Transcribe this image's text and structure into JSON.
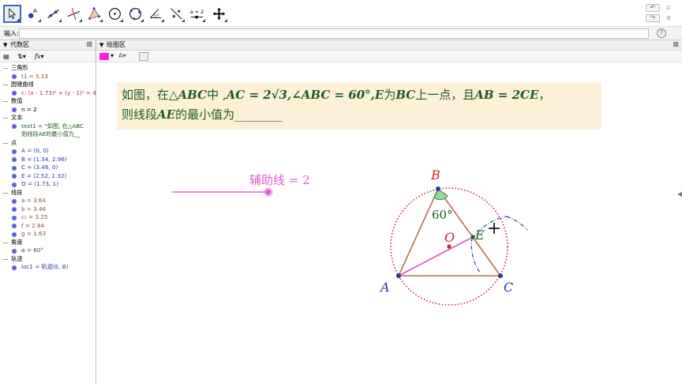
{
  "toolbar": {
    "tools": [
      "move-tool",
      "point-tool",
      "line-tool",
      "perpendicular-tool",
      "polygon-tool",
      "circle-tool",
      "circle-3points-tool",
      "angle-tool",
      "reflect-tool",
      "slider-tool",
      "move-view-tool"
    ],
    "slider_tool_label": "a = 2",
    "point_tool_label": "A"
  },
  "input_bar": {
    "label": "输入:",
    "value": ""
  },
  "algebra": {
    "title": "代数区",
    "categories": [
      {
        "name": "三角形",
        "items": [
          "t1 = 5.13"
        ]
      },
      {
        "name": "圆锥曲线",
        "items": [
          "c: (x - 1.73)² + (y - 1)² = 4"
        ]
      },
      {
        "name": "数值",
        "items": [
          "n = 2"
        ]
      },
      {
        "name": "文本",
        "items": [
          "text1 = \"如图, 在△ABC",
          "则线段AE的最小值为__"
        ]
      },
      {
        "name": "点",
        "items": [
          "A = (0, 0)",
          "B = (1.34, 2.96)",
          "C = (3.46, 0)",
          "E = (2.52, 1.32)",
          "O = (1.73, 1)"
        ]
      },
      {
        "name": "线段",
        "items": [
          "a = 3.64",
          "b = 3.46",
          "c₁ = 3.25",
          "f = 2.84",
          "g = 1.63"
        ]
      },
      {
        "name": "角度",
        "items": [
          "α = 60°"
        ]
      },
      {
        "name": "轨迹",
        "items": [
          "loc1 = 轨迹(E, B)"
        ]
      }
    ]
  },
  "graphics": {
    "title": "绘图区",
    "problem": {
      "line1_a": "如图，在△",
      "line1_b": "ABC",
      "line1_c": "中 ,",
      "line1_d": "AC = 2√3,∠ABC = 60°,E",
      "line1_e": "为",
      "line1_f": "BC",
      "line1_g": "上一点，且",
      "line1_h": "AB = 2CE",
      "line1_i": "，",
      "line2_a": "则线段",
      "line2_b": "AE",
      "line2_c": "的最小值为________"
    },
    "slider_label": "辅助线 = 2",
    "labels": {
      "A": "A",
      "B": "B",
      "C": "C",
      "E": "E",
      "O": "O",
      "angle": "60°"
    },
    "colors": {
      "point": "#2b36a8",
      "triangle": "#b86f4e",
      "circle": "#c9242f",
      "locus": "#2d3f9b",
      "pink": "#e05cd0",
      "text": "#1d5c1d",
      "textbg": "#fdf0d8"
    }
  }
}
